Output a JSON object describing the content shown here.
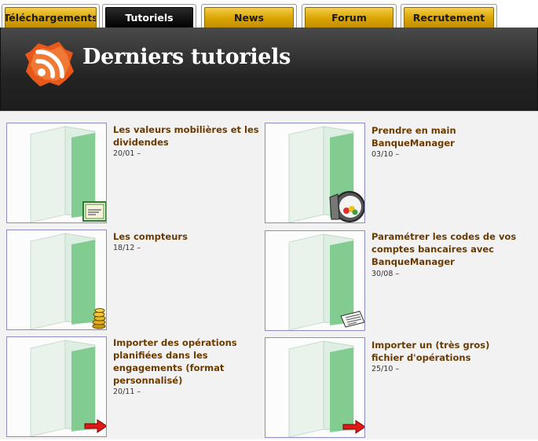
{
  "tabs": [
    {
      "label": "Téléchargements",
      "active": false
    },
    {
      "label": "Tutoriels",
      "active": true
    },
    {
      "label": "News",
      "active": false
    },
    {
      "label": "Forum",
      "active": false
    },
    {
      "label": "Recrutement",
      "active": false
    }
  ],
  "header": {
    "title": "Derniers tutoriels",
    "icon": "rss-icon"
  },
  "tutorials": [
    {
      "title": "Les valeurs mobilières et les dividendes",
      "date": "20/01 –",
      "badge": "certificate-icon"
    },
    {
      "title": "Prendre en main BanqueManager",
      "date": "03/10 –",
      "badge": "safe-icon"
    },
    {
      "title": "Les compteurs",
      "date": "18/12 –",
      "badge": "coins-icon"
    },
    {
      "title": "Paramétrer les codes de vos comptes bancaires avec BanqueManager",
      "date": "30/08 –",
      "badge": "newspaper-icon"
    },
    {
      "title": "Importer des opérations planifiées dans les engagements (format personnalisé)",
      "date": "20/11 –",
      "badge": "arrow-right-icon"
    },
    {
      "title": "Importer un (très gros) fichier d'opérations",
      "date": "25/10 –",
      "badge": "arrow-right-icon"
    }
  ],
  "colors": {
    "tab_gold": "#d9a300",
    "header_dark": "#2a2a2a",
    "title_brown": "#6b3a00",
    "rss_orange": "#e8581a"
  }
}
